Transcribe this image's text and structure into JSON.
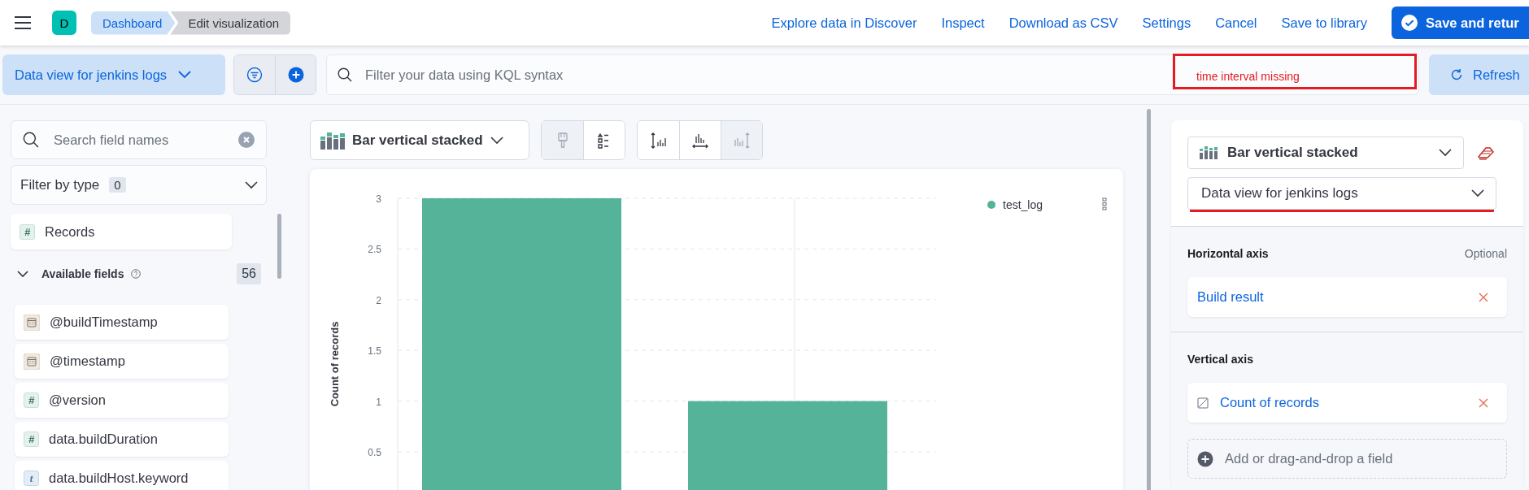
{
  "header": {
    "logo": "D",
    "breadcrumbs": [
      {
        "label": "Dashboard",
        "selected": false
      },
      {
        "label": "Edit visualization",
        "selected": true
      }
    ],
    "links": [
      "Explore data in Discover",
      "Inspect",
      "Download as CSV",
      "Settings",
      "Cancel",
      "Save to library"
    ],
    "primary_button": "Save and retur"
  },
  "query_bar": {
    "data_view": "Data view for jenkins logs",
    "placeholder": "Filter your data using KQL syntax",
    "annotation": "time interval missing",
    "refresh": "Refresh"
  },
  "field_list": {
    "search_placeholder": "Search field names",
    "filter_label": "Filter by type",
    "filter_count": "0",
    "records": {
      "kind": "number",
      "token": "#",
      "name": "Records"
    },
    "section": {
      "title": "Available fields",
      "count": "56",
      "expanded": true
    },
    "fields": [
      {
        "kind": "date",
        "name": "@buildTimestamp"
      },
      {
        "kind": "date",
        "name": "@timestamp"
      },
      {
        "kind": "number",
        "token": "#",
        "name": "@version"
      },
      {
        "kind": "number",
        "token": "#",
        "name": "data.buildDuration"
      },
      {
        "kind": "string",
        "token": "t",
        "name": "data.buildHost.keyword"
      }
    ]
  },
  "workspace": {
    "chart_type": "Bar vertical stacked",
    "toolbar": [
      [
        {
          "kind": "brush",
          "disabled": true
        },
        {
          "kind": "legend",
          "disabled": false
        }
      ],
      [
        {
          "kind": "left-axis",
          "disabled": false
        },
        {
          "kind": "bottom-axis",
          "disabled": false
        },
        {
          "kind": "right-axis",
          "disabled": true
        }
      ]
    ],
    "chart_data": {
      "type": "bar",
      "ylabel": "Count of records",
      "grid": true,
      "ylim": [
        0,
        3
      ],
      "yticks": [
        0.5,
        1,
        1.5,
        2,
        2.5,
        3
      ],
      "series": [
        {
          "name": "test_log",
          "color": "#54b399",
          "values": [
            3,
            1
          ]
        }
      ]
    }
  },
  "config": {
    "chart_type": "Bar vertical stacked",
    "data_view": "Data view for jenkins logs",
    "data_view_underlined": true,
    "groups": [
      {
        "title": "Horizontal axis",
        "note": "Optional",
        "items": [
          {
            "kind": "bucket",
            "label": "Build result"
          }
        ]
      },
      {
        "title": "Vertical axis",
        "items": [
          {
            "kind": "metric",
            "label": "Count of records"
          }
        ],
        "add_placeholder": "Add or drag-and-drop a field"
      }
    ]
  }
}
